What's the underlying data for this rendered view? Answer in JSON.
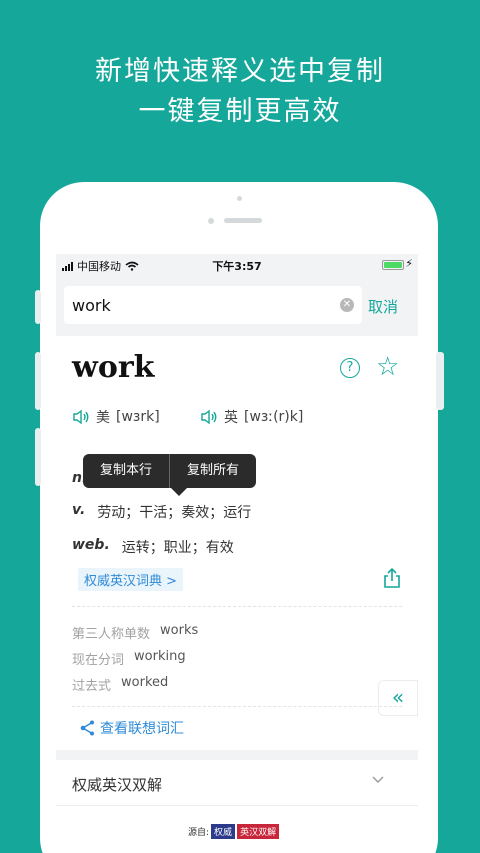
{
  "headline": {
    "line1": "新增快速释义选中复制",
    "line2": "一键复制更高效"
  },
  "statusbar": {
    "carrier": "中国移动",
    "time": "下午3:57",
    "battery_level": 1.0
  },
  "search": {
    "query": "work",
    "cancel": "取消"
  },
  "entry": {
    "word": "work",
    "us_label": "美",
    "us_phonetic": "[wɜrk]",
    "uk_label": "英",
    "uk_phonetic": "[wɜː(r)k]"
  },
  "tooltip": {
    "copy_line": "复制本行",
    "copy_all": "复制所有"
  },
  "definitions": [
    {
      "pos": "n.",
      "text": ""
    },
    {
      "pos": "v.",
      "text": "劳动；干活；奏效；运行"
    },
    {
      "pos": "web.",
      "text": "运转；职业；有效"
    }
  ],
  "dict_link": "权威英汉词典 >",
  "forms": [
    {
      "k": "第三人称单数",
      "v": "works"
    },
    {
      "k": "现在分词",
      "v": "working"
    },
    {
      "k": "过去式",
      "v": "worked"
    }
  ],
  "side_tab": "«",
  "assoc": "查看联想词汇",
  "section": {
    "title": "权威英汉双解"
  },
  "source": {
    "label": "源自:",
    "tag1": "权威",
    "tag2": "英汉双解"
  },
  "colors": {
    "accent": "#16a79b",
    "link": "#2f8bd8"
  },
  "icons": [
    "wifi-icon",
    "signal-icon",
    "battery-icon",
    "clear-icon",
    "help-icon",
    "star-icon",
    "speaker-icon",
    "share-icon",
    "double-chevron-left-icon",
    "tree-icon",
    "chevron-down-icon"
  ]
}
